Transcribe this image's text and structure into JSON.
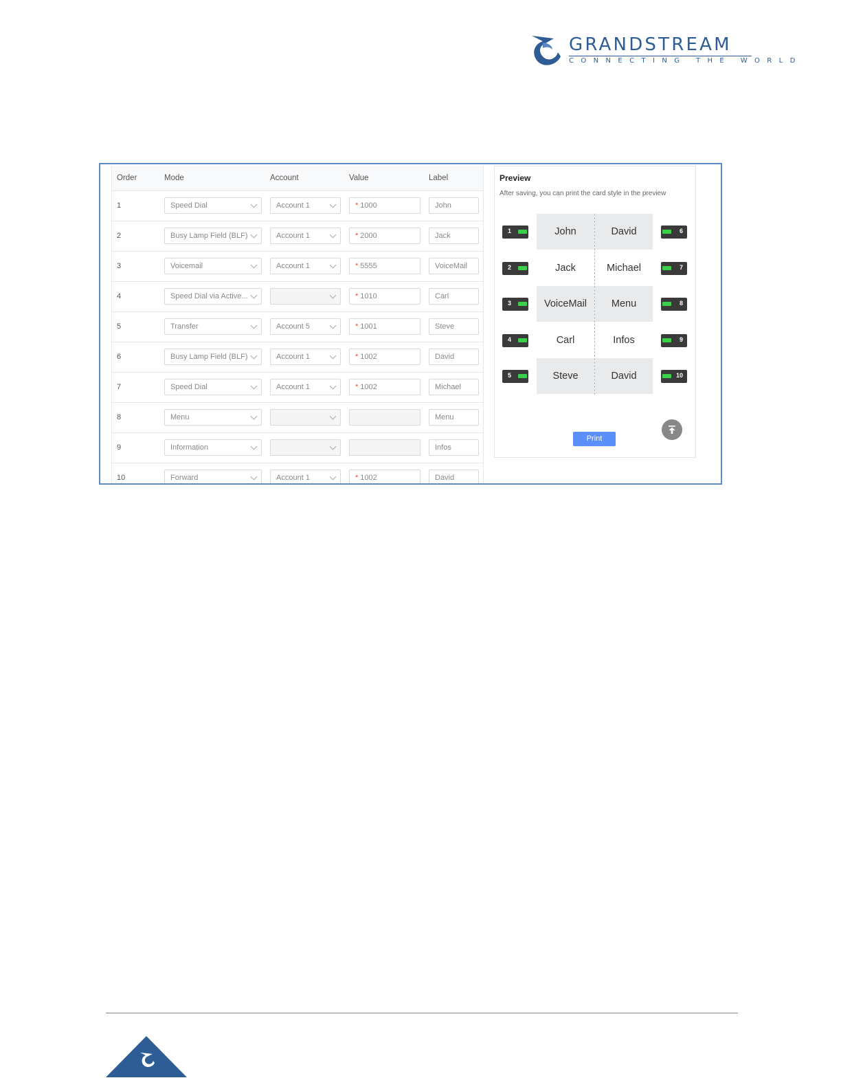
{
  "brand": {
    "name": "GRANDSTREAM",
    "tagline": "CONNECTING THE WORLD",
    "color": "#2e5d95"
  },
  "table": {
    "headers": {
      "order": "Order",
      "mode": "Mode",
      "account": "Account",
      "value": "Value",
      "label": "Label"
    },
    "rows": [
      {
        "order": "1",
        "mode": "Speed Dial",
        "account": "Account 1",
        "value": "1000",
        "label": "John",
        "value_required": true
      },
      {
        "order": "2",
        "mode": "Busy Lamp Field (BLF)",
        "account": "Account 1",
        "value": "2000",
        "label": "Jack",
        "value_required": true
      },
      {
        "order": "3",
        "mode": "Voicemail",
        "account": "Account 1",
        "value": "5555",
        "label": "VoiceMail",
        "value_required": true
      },
      {
        "order": "4",
        "mode": "Speed Dial via Active...",
        "account": "",
        "value": "1010",
        "label": "Carl",
        "value_required": true
      },
      {
        "order": "5",
        "mode": "Transfer",
        "account": "Account 5",
        "value": "1001",
        "label": "Steve",
        "value_required": true
      },
      {
        "order": "6",
        "mode": "Busy Lamp Field (BLF)",
        "account": "Account 1",
        "value": "1002",
        "label": "David",
        "value_required": true
      },
      {
        "order": "7",
        "mode": "Speed Dial",
        "account": "Account 1",
        "value": "1002",
        "label": "Michael",
        "value_required": true
      },
      {
        "order": "8",
        "mode": "Menu",
        "account": "",
        "value": "",
        "label": "Menu",
        "value_required": false
      },
      {
        "order": "9",
        "mode": "Information",
        "account": "",
        "value": "",
        "label": "Infos",
        "value_required": false
      },
      {
        "order": "10",
        "mode": "Forward",
        "account": "Account 1",
        "value": "1002",
        "label": "David",
        "value_required": true
      }
    ]
  },
  "preview": {
    "title": "Preview",
    "subtitle": "After saving, you can print the card style in the preview",
    "card": {
      "left": [
        "John",
        "Jack",
        "VoiceMail",
        "Carl",
        "Steve"
      ],
      "right": [
        "David",
        "Michael",
        "Menu",
        "Infos",
        "David"
      ]
    },
    "left_keys": [
      "1",
      "2",
      "3",
      "4",
      "5"
    ],
    "right_keys": [
      "6",
      "7",
      "8",
      "9",
      "10"
    ],
    "print_label": "Print",
    "led_color": "#3bd04b"
  }
}
